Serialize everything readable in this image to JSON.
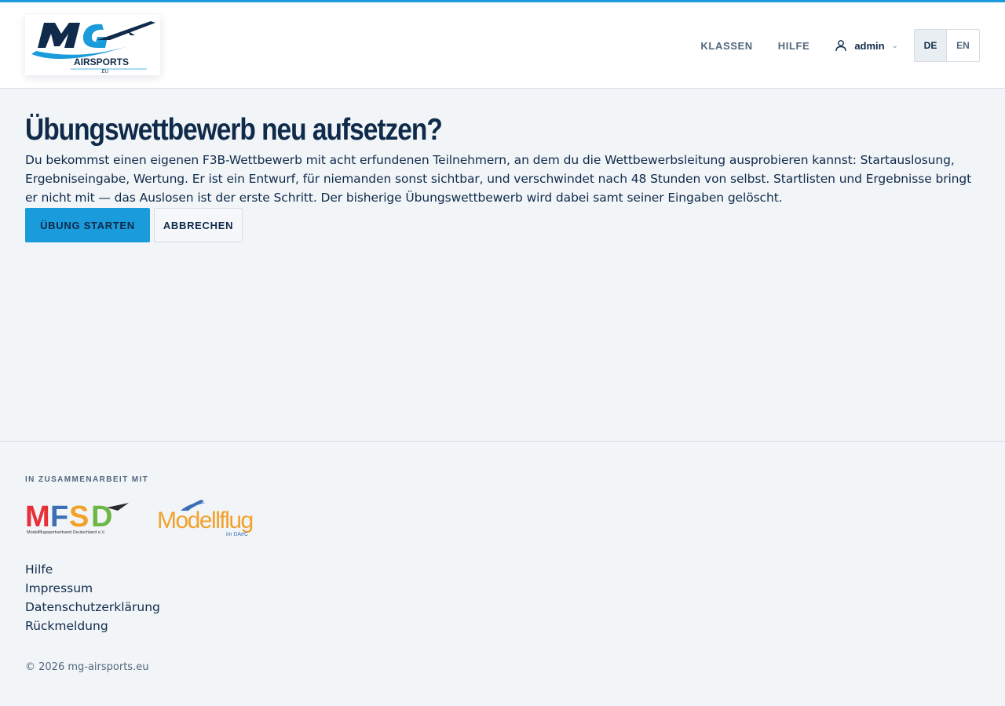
{
  "header": {
    "logo": {
      "main": "MG",
      "sub": "AIRSPORTS",
      "tld": ".EU"
    },
    "nav": [
      {
        "label": "KLASSEN"
      },
      {
        "label": "HILFE"
      }
    ],
    "user": {
      "name": "admin",
      "icon": "user-icon",
      "caret": "⌄"
    },
    "languages": [
      {
        "code": "DE",
        "active": true
      },
      {
        "code": "EN",
        "active": false
      }
    ]
  },
  "main": {
    "title": "Übungswettbewerb neu aufsetzen?",
    "intro": "Du bekommst einen eigenen F3B-Wettbewerb mit acht erfundenen Teilnehmern, an dem du die Wettbewerbsleitung ausprobieren kannst: Startauslosung, Ergebniseingabe, Wertung. Er ist ein Entwurf, für niemanden sonst sichtbar, und verschwindet nach 48 Stunden von selbst. Startlisten und Ergebnisse bringt er nicht mit — das Auslosen ist der erste Schritt. Der bisherige Übungswettbewerb wird dabei samt seiner Eingaben gelöscht.",
    "primary_button": "ÜBUNG STARTEN",
    "secondary_button": "ABBRECHEN"
  },
  "footer": {
    "partners_heading": "IN ZUSAMMENARBEIT MIT",
    "partners": [
      {
        "name": "MFSD",
        "subtitle": "Modellflugsportverband Deutschland e.V."
      },
      {
        "name": "Modellflug",
        "subtitle": "im DAeC"
      }
    ],
    "links": [
      {
        "label": "Hilfe"
      },
      {
        "label": "Impressum"
      },
      {
        "label": "Datenschutzerklärung"
      },
      {
        "label": "Rückmeldung"
      }
    ],
    "copyright": "© 2026 mg-airsports.eu"
  },
  "colors": {
    "accent": "#1a9bdb",
    "navy": "#0f2a4a",
    "muted": "#52677d",
    "background": "#f2f5f8"
  }
}
